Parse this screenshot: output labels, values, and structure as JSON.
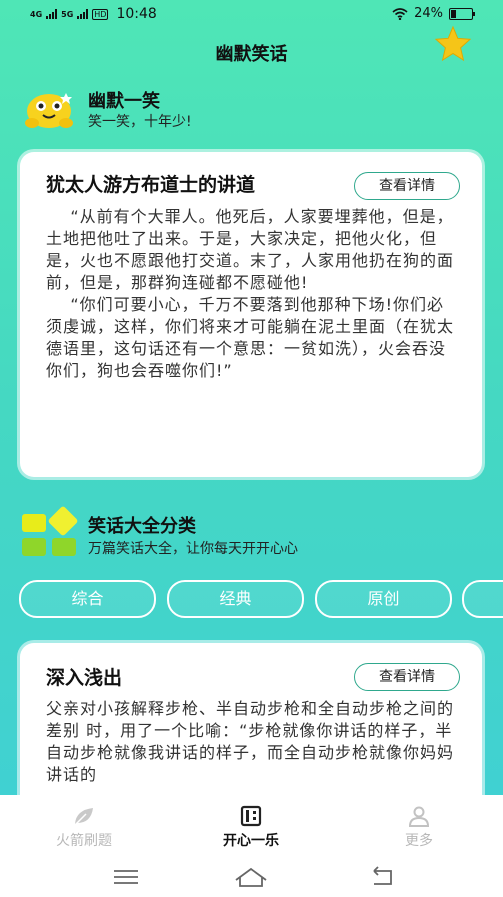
{
  "status_bar": {
    "network_1": "4G",
    "network_2": "5G",
    "hd": "HD",
    "time": "10:48",
    "battery": "24%",
    "battery_level": 0.24
  },
  "app_title": "幽默笑话",
  "humor_section": {
    "title": "幽默一笑",
    "subtitle": "笑一笑，十年少!"
  },
  "featured_card": {
    "title": "犹太人游方布道士的讲道",
    "button": "查看详情",
    "body": "    “从前有个大罪人。他死后，人家要埋葬他，但是，土地把他吐了出来。于是，大家决定，把他火化，但是，火也不愿跟他打交道。末了，人家用他扔在狗的面前，但是，那群狗连碰都不愿碰他!\n    “你们可要小心，千万不要落到他那种下场!你们必须虔诚，这样，你们将来才可能躺在泥土里面（在犹太德语里，这句话还有一个意思：一贫如洗），火会吞没你们，狗也会吞噬你们!”"
  },
  "category_section": {
    "title": "笑话大全分类",
    "subtitle": "万篇笑话大全，让你每天开开心心",
    "tabs": [
      "综合",
      "经典",
      "原创",
      ""
    ]
  },
  "second_card": {
    "title": "深入浅出",
    "button": "查看详情",
    "body": "父亲对小孩解释步枪、半自动步枪和全自动步枪之间的差别 时，用了一个比喻：“步枪就像你讲话的样子，半自动步枪就像我讲话的样子，而全自动步枪就像你妈妈讲话的"
  },
  "tab_bar": [
    {
      "label": "火箭刷题",
      "icon": "leaf-icon",
      "active": false
    },
    {
      "label": "开心一乐",
      "icon": "film-icon",
      "active": true
    },
    {
      "label": "更多",
      "icon": "person-icon",
      "active": false
    }
  ],
  "colors": {
    "gradient_top": "#4fe6b6",
    "gradient_bottom": "#3fcfd6",
    "accent": "#2fa88d",
    "star": "#f5c518",
    "mascot": "#f7d21e",
    "category_green": "#8fd62a",
    "category_yellow": "#e8ec1a"
  }
}
